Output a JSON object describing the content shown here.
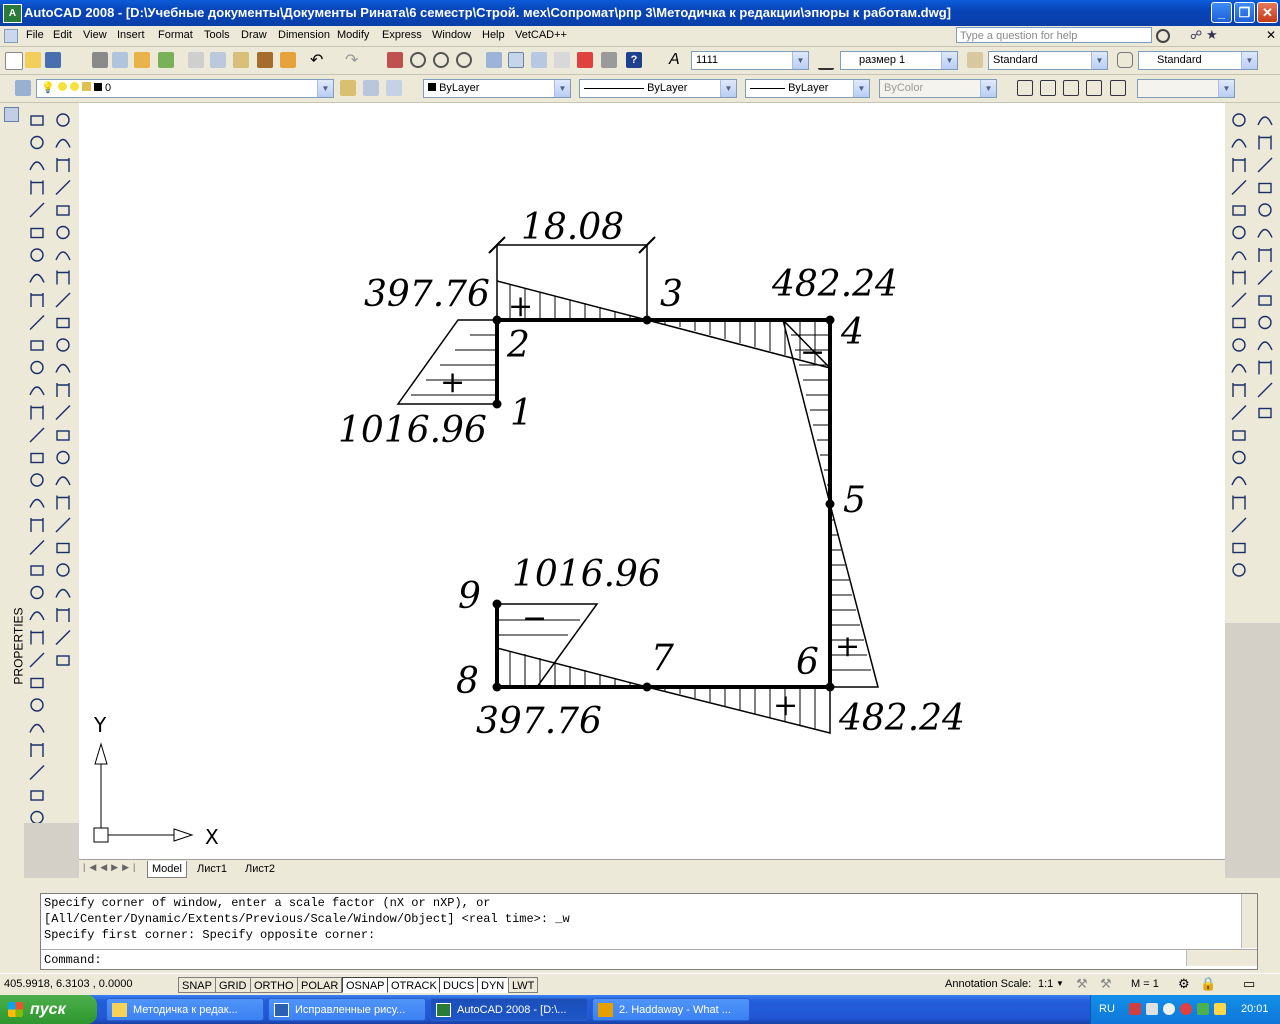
{
  "window": {
    "title": "AutoCAD 2008 - [D:\\Учебные документы\\Документы Рината\\6 семестр\\Строй. мех\\Сопромат\\рпр 3\\Методичка к редакции\\эпюры к работам.dwg]",
    "app_icon": "autocad-icon",
    "minimize": "_",
    "maximize": "❐",
    "close": "✕"
  },
  "menu": {
    "items": [
      "File",
      "Edit",
      "View",
      "Insert",
      "Format",
      "Tools",
      "Draw",
      "Dimension",
      "Modify",
      "Express",
      "Window",
      "Help",
      "VetCAD++"
    ],
    "help_placeholder": "Type a question for help"
  },
  "toolbar1": {
    "text_style": "1111",
    "dim_style": "размер 1",
    "table_style": "Standard",
    "multileader_style": "Standard"
  },
  "toolbar2": {
    "layer": "0",
    "color": "ByLayer",
    "linetype": "ByLayer",
    "lineweight": "ByLayer",
    "plotstyle": "ByColor"
  },
  "palette": {
    "label": "PROPERTIES"
  },
  "drawing": {
    "dim_top": "18.08",
    "labels": {
      "v_397_top": "397.76",
      "v_1016_left": "1016.96",
      "v_482_top": "482.24",
      "v_1016_bottom": "1016.96",
      "v_397_bottom": "397.76",
      "v_482_bottom": "482.24"
    },
    "nodes": {
      "n1": "1",
      "n2": "2",
      "n3": "3",
      "n4": "4",
      "n5": "5",
      "n6": "6",
      "n7": "7",
      "n8": "8",
      "n9": "9"
    },
    "signs": {
      "plus": "+",
      "minus": "−"
    },
    "ucs": {
      "x": "X",
      "y": "Y"
    }
  },
  "layout_tabs": [
    "Model",
    "Лист1",
    "Лист2"
  ],
  "command": {
    "lines": [
      "Specify corner of window, enter a scale factor (nX or nXP), or",
      "[All/Center/Dynamic/Extents/Previous/Scale/Window/Object] <real time>: _w",
      "Specify first corner: Specify opposite corner:"
    ],
    "prompt": "Command:"
  },
  "status": {
    "coords": "405.9918, 6.3103 , 0.0000",
    "buttons": [
      {
        "label": "SNAP",
        "on": false
      },
      {
        "label": "GRID",
        "on": false
      },
      {
        "label": "ORTHO",
        "on": false
      },
      {
        "label": "POLAR",
        "on": false
      },
      {
        "label": "OSNAP",
        "on": true
      },
      {
        "label": "OTRACK",
        "on": true
      },
      {
        "label": "DUCS",
        "on": true
      },
      {
        "label": "DYN",
        "on": true
      },
      {
        "label": "LWT",
        "on": false
      }
    ],
    "annotation_scale_label": "Annotation Scale:",
    "annotation_scale": "1:1",
    "m_value": "M = 1"
  },
  "taskbar": {
    "start": "пуск",
    "tasks": [
      {
        "label": "Методичка к редак...",
        "icon": "folder-icon",
        "active": false
      },
      {
        "label": "Исправленные рису...",
        "icon": "word-icon",
        "active": false
      },
      {
        "label": "AutoCAD 2008 - [D:\\...",
        "icon": "autocad-icon",
        "active": true
      },
      {
        "label": "2. Haddaway - What ...",
        "icon": "winamp-icon",
        "active": false
      }
    ],
    "lang": "RU",
    "clock": "20:01"
  }
}
